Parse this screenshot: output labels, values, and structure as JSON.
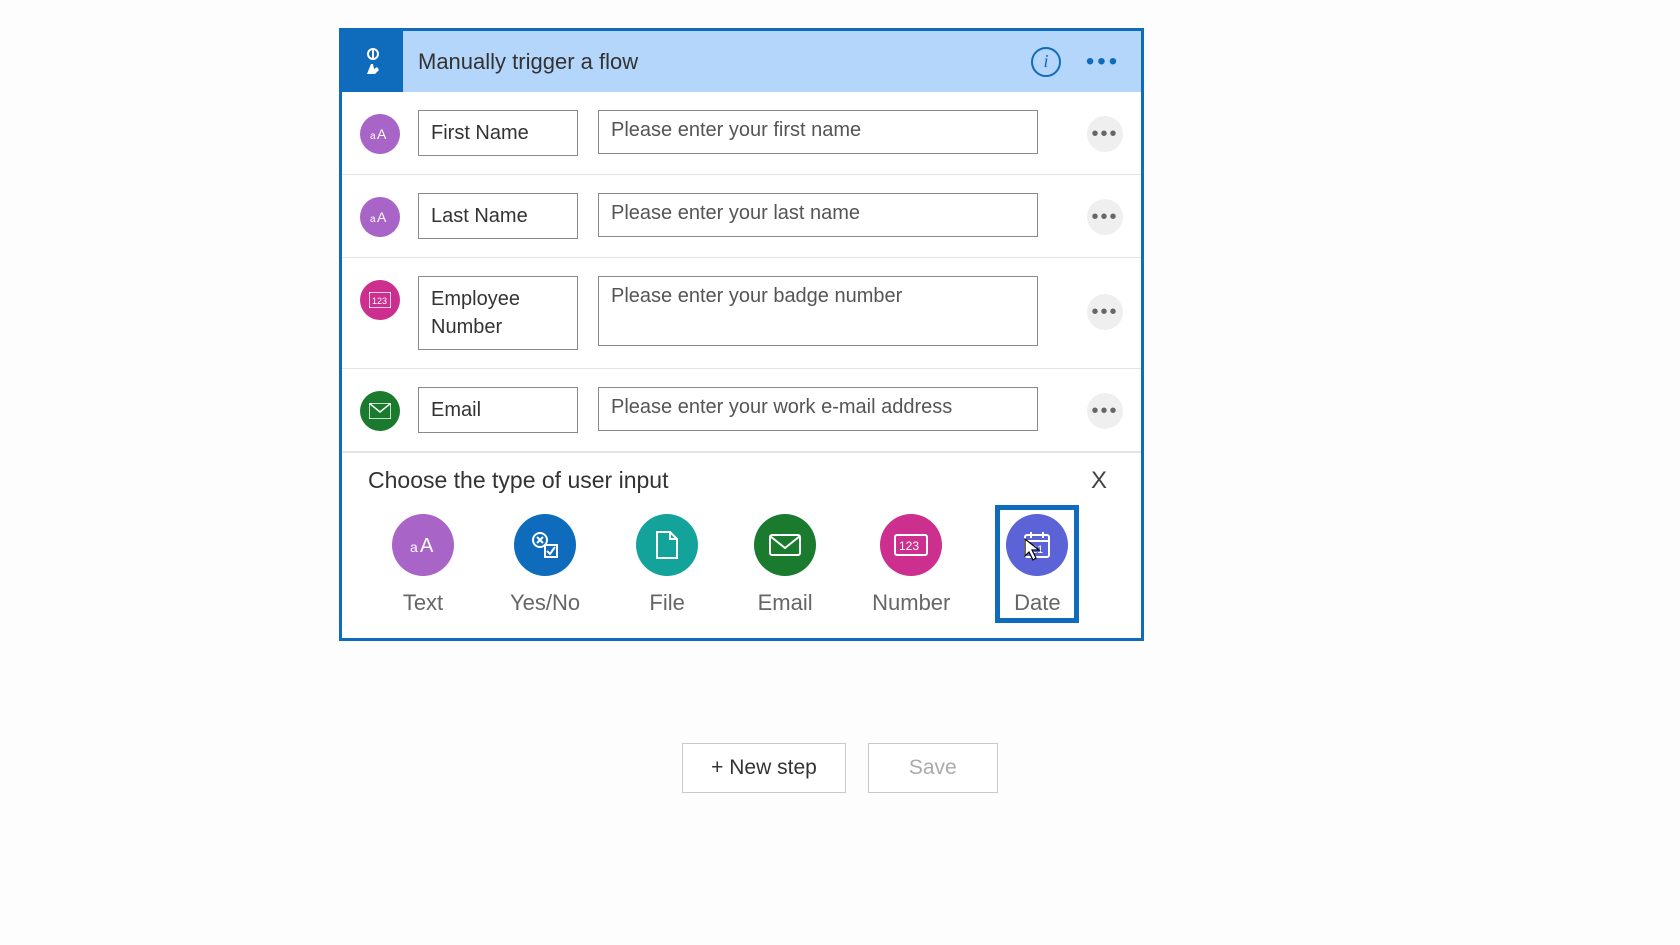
{
  "header": {
    "title": "Manually trigger a flow"
  },
  "rows": [
    {
      "name": "First Name",
      "prompt": "Please enter your first name",
      "badge": "text"
    },
    {
      "name": "Last Name",
      "prompt": "Please enter your last name",
      "badge": "text"
    },
    {
      "name": "Employee Number",
      "prompt": "Please enter your badge number",
      "badge": "number"
    },
    {
      "name": "Email",
      "prompt": "Please enter your work e-mail address",
      "badge": "email"
    }
  ],
  "addInput": {
    "title": "Choose the type of user input",
    "close": "X",
    "types": [
      {
        "key": "text",
        "label": "Text"
      },
      {
        "key": "yesno",
        "label": "Yes/No"
      },
      {
        "key": "file",
        "label": "File"
      },
      {
        "key": "email",
        "label": "Email"
      },
      {
        "key": "number",
        "label": "Number"
      },
      {
        "key": "date",
        "label": "Date"
      }
    ],
    "selected": "date"
  },
  "footer": {
    "newStep": "+ New step",
    "save": "Save"
  }
}
